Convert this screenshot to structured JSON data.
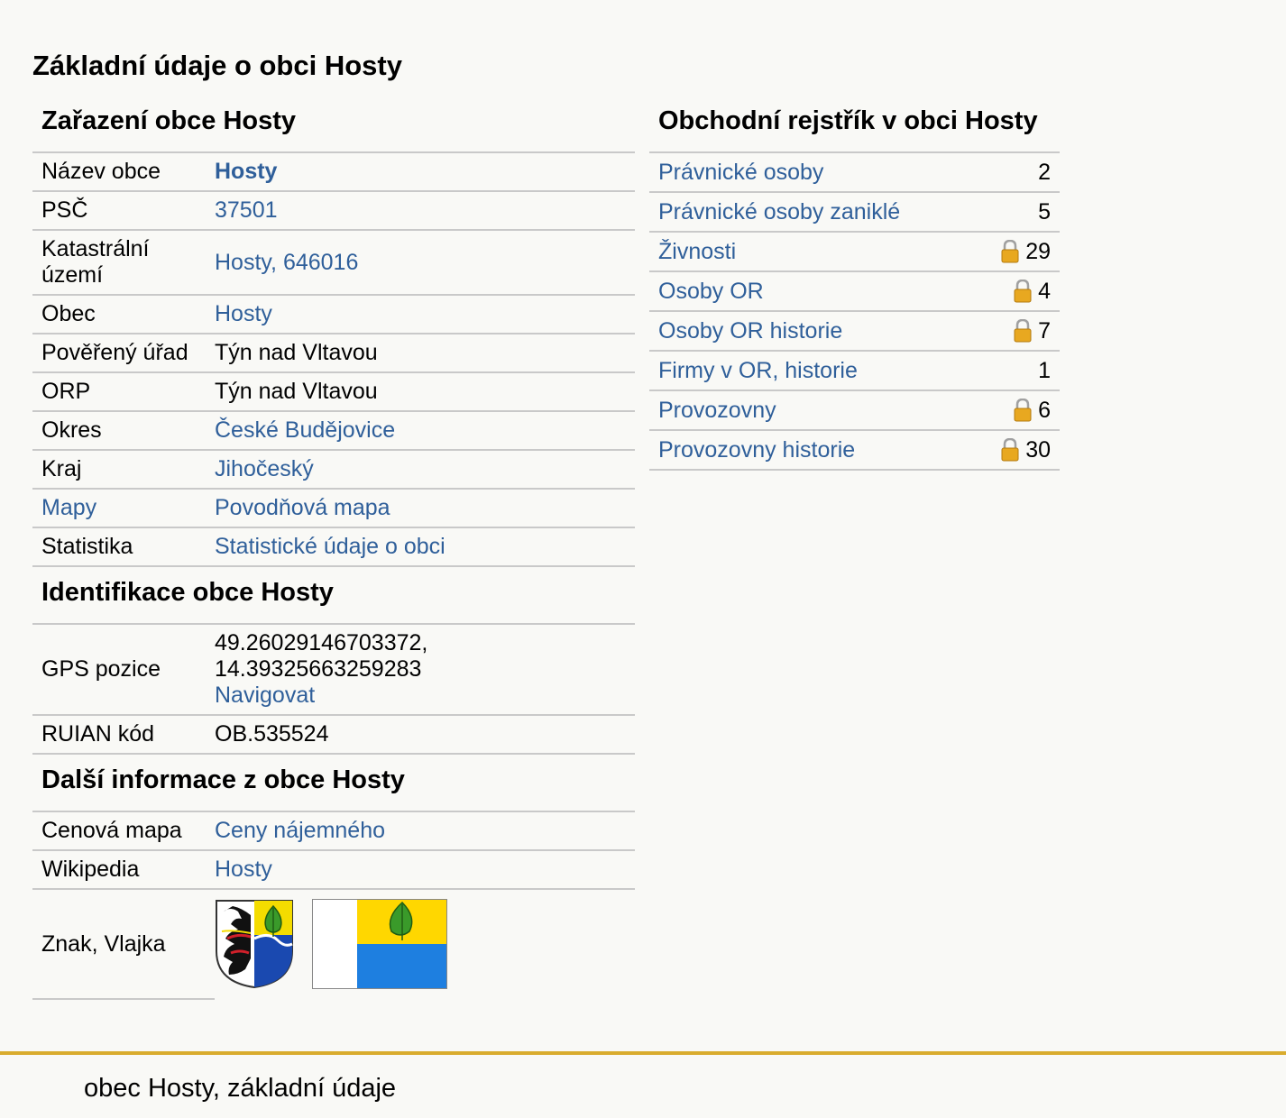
{
  "page_title": "Základní údaje o obci Hosty",
  "zarazeni": {
    "heading": "Zařazení obce Hosty",
    "rows": [
      {
        "key": "Název obce",
        "value": "Hosty"
      },
      {
        "key": "PSČ",
        "value": "37501"
      },
      {
        "key": "Katastrální území",
        "value": "Hosty, 646016"
      },
      {
        "key": "Obec",
        "value": "Hosty"
      },
      {
        "key": "Pověřený úřad",
        "value": "Týn nad Vltavou"
      },
      {
        "key": "ORP",
        "value": "Týn nad Vltavou"
      },
      {
        "key": "Okres",
        "value": "České Budějovice"
      },
      {
        "key": "Kraj",
        "value": "Jihočeský"
      },
      {
        "key": "Mapy",
        "value": "Povodňová mapa"
      },
      {
        "key": "Statistika",
        "value": "Statistické údaje o obci"
      }
    ]
  },
  "identifikace": {
    "heading": "Identifikace obce Hosty",
    "gps_label": "GPS pozice",
    "gps_lat": "49.26029146703372,",
    "gps_lon": "14.39325663259283",
    "navigate_label": "Navigovat",
    "ruian_label": "RUIAN kód",
    "ruian_value": "OB.535524"
  },
  "dalsi": {
    "heading": "Další informace z obce Hosty",
    "cenova_label": "Cenová mapa",
    "cenova_value": "Ceny nájemného",
    "wiki_label": "Wikipedia",
    "wiki_value": "Hosty",
    "znak_label": "Znak, Vlajka"
  },
  "obchodni": {
    "heading": "Obchodní rejstřík v obci Hosty",
    "rows": [
      {
        "label": "Právnické osoby",
        "count": "2",
        "locked": false
      },
      {
        "label": "Právnické osoby zaniklé",
        "count": "5",
        "locked": false
      },
      {
        "label": "Živnosti",
        "count": "29",
        "locked": true
      },
      {
        "label": "Osoby OR",
        "count": "4",
        "locked": true
      },
      {
        "label": "Osoby OR historie",
        "count": "7",
        "locked": true
      },
      {
        "label": "Firmy v OR, historie",
        "count": "1",
        "locked": false
      },
      {
        "label": "Provozovny",
        "count": "6",
        "locked": true
      },
      {
        "label": "Provozovny historie",
        "count": "30",
        "locked": true
      }
    ]
  },
  "footer_text": "obec Hosty, základní údaje",
  "colors": {
    "link": "#2f5f9a",
    "footer_line": "#d9ac2e",
    "background": "#f9f9f6"
  },
  "icons": {
    "lock": "lock-icon",
    "coat_of_arms": "coat-of-arms-image",
    "flag": "flag-image"
  }
}
